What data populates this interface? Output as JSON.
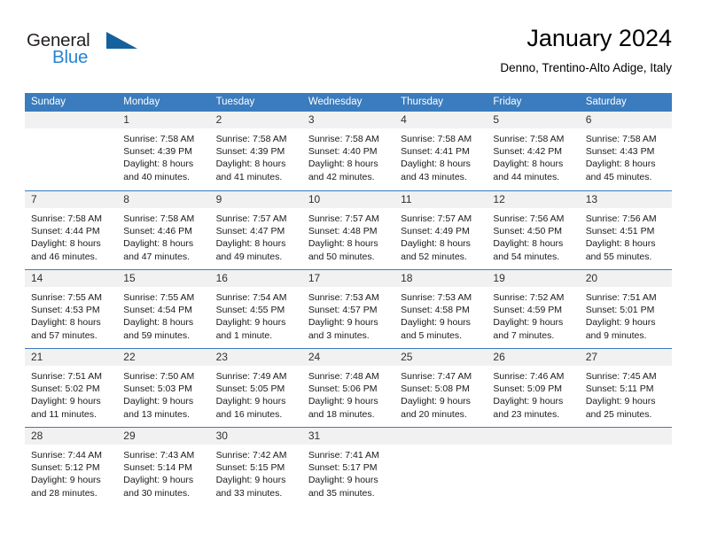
{
  "brand": {
    "name_part1": "General",
    "name_part2": "Blue",
    "flag_icon": "blue-flag-triangle-icon",
    "blue_hex": "#2585d3",
    "dark_hex": "#231f20"
  },
  "header": {
    "title": "January 2024",
    "subtitle": "Denno, Trentino-Alto Adige, Italy"
  },
  "theme": {
    "header_bg": "#3a7cbe",
    "header_text": "#ffffff",
    "day_band_bg": "#f1f1f1",
    "week_divider": "#3a7cbe"
  },
  "calendar": {
    "weekdays": [
      "Sunday",
      "Monday",
      "Tuesday",
      "Wednesday",
      "Thursday",
      "Friday",
      "Saturday"
    ],
    "weeks": [
      [
        {
          "day": "",
          "empty": true
        },
        {
          "day": "1",
          "sunrise": "Sunrise: 7:58 AM",
          "sunset": "Sunset: 4:39 PM",
          "daylight1": "Daylight: 8 hours",
          "daylight2": "and 40 minutes."
        },
        {
          "day": "2",
          "sunrise": "Sunrise: 7:58 AM",
          "sunset": "Sunset: 4:39 PM",
          "daylight1": "Daylight: 8 hours",
          "daylight2": "and 41 minutes."
        },
        {
          "day": "3",
          "sunrise": "Sunrise: 7:58 AM",
          "sunset": "Sunset: 4:40 PM",
          "daylight1": "Daylight: 8 hours",
          "daylight2": "and 42 minutes."
        },
        {
          "day": "4",
          "sunrise": "Sunrise: 7:58 AM",
          "sunset": "Sunset: 4:41 PM",
          "daylight1": "Daylight: 8 hours",
          "daylight2": "and 43 minutes."
        },
        {
          "day": "5",
          "sunrise": "Sunrise: 7:58 AM",
          "sunset": "Sunset: 4:42 PM",
          "daylight1": "Daylight: 8 hours",
          "daylight2": "and 44 minutes."
        },
        {
          "day": "6",
          "sunrise": "Sunrise: 7:58 AM",
          "sunset": "Sunset: 4:43 PM",
          "daylight1": "Daylight: 8 hours",
          "daylight2": "and 45 minutes."
        }
      ],
      [
        {
          "day": "7",
          "sunrise": "Sunrise: 7:58 AM",
          "sunset": "Sunset: 4:44 PM",
          "daylight1": "Daylight: 8 hours",
          "daylight2": "and 46 minutes."
        },
        {
          "day": "8",
          "sunrise": "Sunrise: 7:58 AM",
          "sunset": "Sunset: 4:46 PM",
          "daylight1": "Daylight: 8 hours",
          "daylight2": "and 47 minutes."
        },
        {
          "day": "9",
          "sunrise": "Sunrise: 7:57 AM",
          "sunset": "Sunset: 4:47 PM",
          "daylight1": "Daylight: 8 hours",
          "daylight2": "and 49 minutes."
        },
        {
          "day": "10",
          "sunrise": "Sunrise: 7:57 AM",
          "sunset": "Sunset: 4:48 PM",
          "daylight1": "Daylight: 8 hours",
          "daylight2": "and 50 minutes."
        },
        {
          "day": "11",
          "sunrise": "Sunrise: 7:57 AM",
          "sunset": "Sunset: 4:49 PM",
          "daylight1": "Daylight: 8 hours",
          "daylight2": "and 52 minutes."
        },
        {
          "day": "12",
          "sunrise": "Sunrise: 7:56 AM",
          "sunset": "Sunset: 4:50 PM",
          "daylight1": "Daylight: 8 hours",
          "daylight2": "and 54 minutes."
        },
        {
          "day": "13",
          "sunrise": "Sunrise: 7:56 AM",
          "sunset": "Sunset: 4:51 PM",
          "daylight1": "Daylight: 8 hours",
          "daylight2": "and 55 minutes."
        }
      ],
      [
        {
          "day": "14",
          "sunrise": "Sunrise: 7:55 AM",
          "sunset": "Sunset: 4:53 PM",
          "daylight1": "Daylight: 8 hours",
          "daylight2": "and 57 minutes."
        },
        {
          "day": "15",
          "sunrise": "Sunrise: 7:55 AM",
          "sunset": "Sunset: 4:54 PM",
          "daylight1": "Daylight: 8 hours",
          "daylight2": "and 59 minutes."
        },
        {
          "day": "16",
          "sunrise": "Sunrise: 7:54 AM",
          "sunset": "Sunset: 4:55 PM",
          "daylight1": "Daylight: 9 hours",
          "daylight2": "and 1 minute."
        },
        {
          "day": "17",
          "sunrise": "Sunrise: 7:53 AM",
          "sunset": "Sunset: 4:57 PM",
          "daylight1": "Daylight: 9 hours",
          "daylight2": "and 3 minutes."
        },
        {
          "day": "18",
          "sunrise": "Sunrise: 7:53 AM",
          "sunset": "Sunset: 4:58 PM",
          "daylight1": "Daylight: 9 hours",
          "daylight2": "and 5 minutes."
        },
        {
          "day": "19",
          "sunrise": "Sunrise: 7:52 AM",
          "sunset": "Sunset: 4:59 PM",
          "daylight1": "Daylight: 9 hours",
          "daylight2": "and 7 minutes."
        },
        {
          "day": "20",
          "sunrise": "Sunrise: 7:51 AM",
          "sunset": "Sunset: 5:01 PM",
          "daylight1": "Daylight: 9 hours",
          "daylight2": "and 9 minutes."
        }
      ],
      [
        {
          "day": "21",
          "sunrise": "Sunrise: 7:51 AM",
          "sunset": "Sunset: 5:02 PM",
          "daylight1": "Daylight: 9 hours",
          "daylight2": "and 11 minutes."
        },
        {
          "day": "22",
          "sunrise": "Sunrise: 7:50 AM",
          "sunset": "Sunset: 5:03 PM",
          "daylight1": "Daylight: 9 hours",
          "daylight2": "and 13 minutes."
        },
        {
          "day": "23",
          "sunrise": "Sunrise: 7:49 AM",
          "sunset": "Sunset: 5:05 PM",
          "daylight1": "Daylight: 9 hours",
          "daylight2": "and 16 minutes."
        },
        {
          "day": "24",
          "sunrise": "Sunrise: 7:48 AM",
          "sunset": "Sunset: 5:06 PM",
          "daylight1": "Daylight: 9 hours",
          "daylight2": "and 18 minutes."
        },
        {
          "day": "25",
          "sunrise": "Sunrise: 7:47 AM",
          "sunset": "Sunset: 5:08 PM",
          "daylight1": "Daylight: 9 hours",
          "daylight2": "and 20 minutes."
        },
        {
          "day": "26",
          "sunrise": "Sunrise: 7:46 AM",
          "sunset": "Sunset: 5:09 PM",
          "daylight1": "Daylight: 9 hours",
          "daylight2": "and 23 minutes."
        },
        {
          "day": "27",
          "sunrise": "Sunrise: 7:45 AM",
          "sunset": "Sunset: 5:11 PM",
          "daylight1": "Daylight: 9 hours",
          "daylight2": "and 25 minutes."
        }
      ],
      [
        {
          "day": "28",
          "sunrise": "Sunrise: 7:44 AM",
          "sunset": "Sunset: 5:12 PM",
          "daylight1": "Daylight: 9 hours",
          "daylight2": "and 28 minutes."
        },
        {
          "day": "29",
          "sunrise": "Sunrise: 7:43 AM",
          "sunset": "Sunset: 5:14 PM",
          "daylight1": "Daylight: 9 hours",
          "daylight2": "and 30 minutes."
        },
        {
          "day": "30",
          "sunrise": "Sunrise: 7:42 AM",
          "sunset": "Sunset: 5:15 PM",
          "daylight1": "Daylight: 9 hours",
          "daylight2": "and 33 minutes."
        },
        {
          "day": "31",
          "sunrise": "Sunrise: 7:41 AM",
          "sunset": "Sunset: 5:17 PM",
          "daylight1": "Daylight: 9 hours",
          "daylight2": "and 35 minutes."
        },
        {
          "day": "",
          "empty": true
        },
        {
          "day": "",
          "empty": true
        },
        {
          "day": "",
          "empty": true
        }
      ]
    ]
  }
}
